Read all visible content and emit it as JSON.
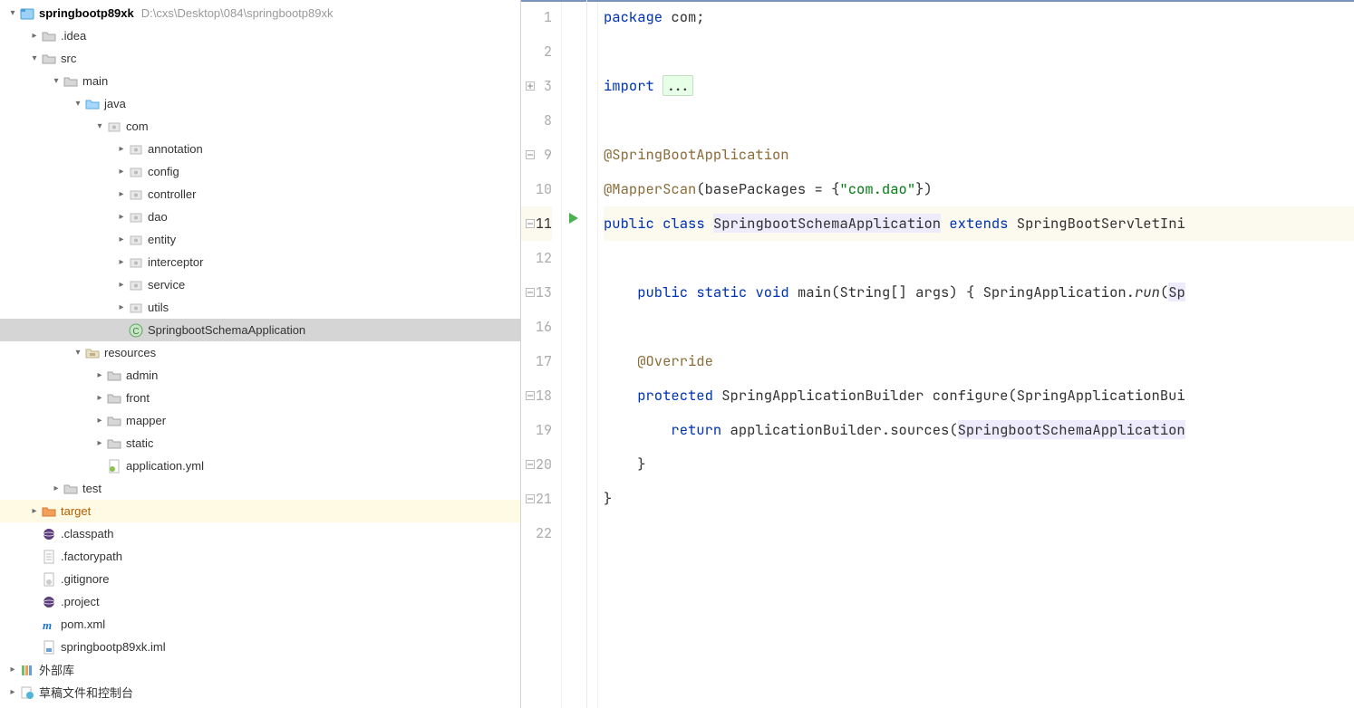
{
  "project": {
    "name": "springbootp89xk",
    "path": "D:\\cxs\\Desktop\\084\\springbootp89xk"
  },
  "tree": {
    "idea": ".idea",
    "src": "src",
    "main": "main",
    "java": "java",
    "com": "com",
    "annotation": "annotation",
    "config": "config",
    "controller": "controller",
    "dao": "dao",
    "entity": "entity",
    "interceptor": "interceptor",
    "service": "service",
    "utils": "utils",
    "app_class": "SpringbootSchemaApplication",
    "resources": "resources",
    "admin": "admin",
    "front": "front",
    "mapper": "mapper",
    "static": "static",
    "application_yml": "application.yml",
    "test": "test",
    "target": "target",
    "classpath": ".classpath",
    "factorypath": ".factorypath",
    "gitignore": ".gitignore",
    "project_file": ".project",
    "pom": "pom.xml",
    "iml": "springbootp89xk.iml",
    "ext_libs": "外部库",
    "scratches": "草稿文件和控制台"
  },
  "code": {
    "ln1": "1",
    "ln2": "2",
    "ln3": "3",
    "ln8": "8",
    "ln9": "9",
    "ln10": "10",
    "ln11": "11",
    "ln12": "12",
    "ln13": "13",
    "ln16": "16",
    "ln17": "17",
    "ln18": "18",
    "ln19": "19",
    "ln20": "20",
    "ln21": "21",
    "ln22": "22",
    "package": "package",
    "pkg_name": " com;",
    "import": "import",
    "import_fold": "...",
    "ann1": "@SpringBootApplication",
    "ann2": "@MapperScan",
    "ann2_args_open": "(basePackages = {",
    "ann2_str": "\"com.dao\"",
    "ann2_args_close": "})",
    "public": "public",
    "class": "class",
    "class_name": "SpringbootSchemaApplication",
    "extends": "extends",
    "super_class": "SpringBootServletIni",
    "static": "static",
    "void": "void",
    "main_sig": " main(String[] args) { ",
    "main_body": "SpringApplication.",
    "run": "run",
    "run_open": "(",
    "run_arg": "Sp",
    "override": "@Override",
    "protected": "protected",
    "builder_type": "SpringApplicationBuilder",
    "configure": " configure(",
    "builder_param": "SpringApplicationBui",
    "return": "return",
    "return_body1": " applicationBuilder.sources(",
    "return_body2": "SpringbootSchemaApplication",
    "brace_close": "}"
  }
}
